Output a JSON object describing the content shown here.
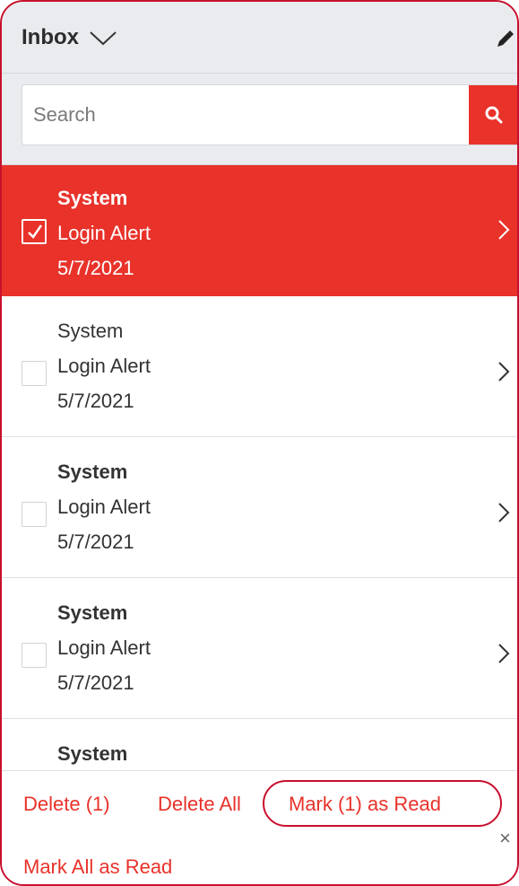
{
  "header": {
    "title": "Inbox"
  },
  "search": {
    "placeholder": "Search"
  },
  "messages": [
    {
      "sender": "System",
      "subject": "Login Alert",
      "date": "5/7/2021",
      "selected": true,
      "unread": true
    },
    {
      "sender": "System",
      "subject": "Login Alert",
      "date": "5/7/2021",
      "selected": false,
      "unread": false
    },
    {
      "sender": "System",
      "subject": "Login Alert",
      "date": "5/7/2021",
      "selected": false,
      "unread": true
    },
    {
      "sender": "System",
      "subject": "Login Alert",
      "date": "5/7/2021",
      "selected": false,
      "unread": true
    },
    {
      "sender": "System",
      "subject": "",
      "date": "",
      "selected": false,
      "unread": true
    }
  ],
  "footer": {
    "delete_selected": "Delete (1)",
    "delete_all": "Delete All",
    "mark_selected_read": "Mark (1) as Read",
    "mark_all_read": "Mark All as Read",
    "close": "×"
  },
  "colors": {
    "accent": "#e8322a",
    "highlight_ring": "#c8102e",
    "header_bg": "#e9ebee"
  },
  "icons": {
    "dropdown": "chevron-down-icon",
    "edit": "pencil-icon",
    "search": "search-icon",
    "row_open": "chevron-right-icon",
    "checkbox": "check-icon"
  }
}
